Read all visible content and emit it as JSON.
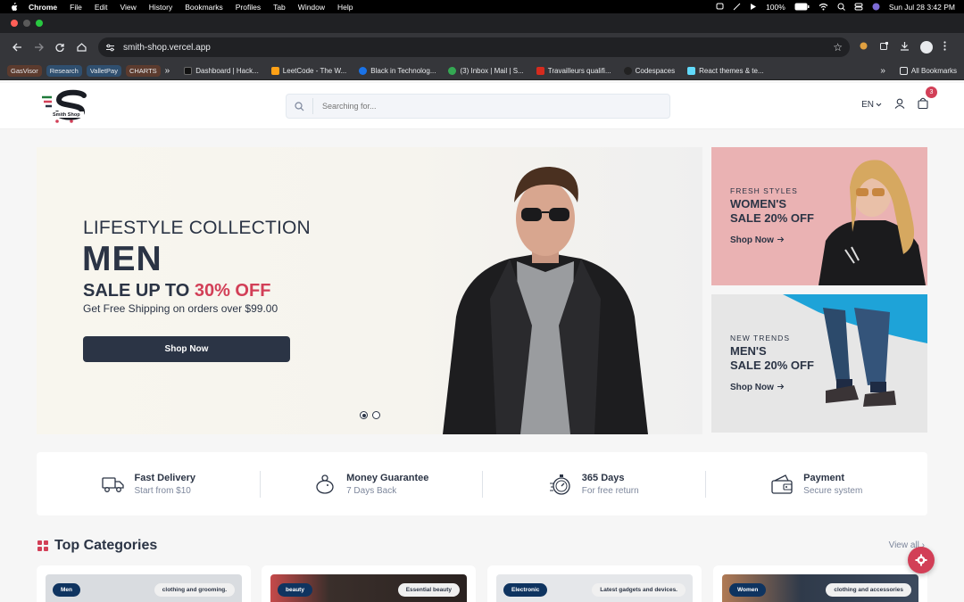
{
  "menubar": {
    "app": "Chrome",
    "items": [
      "File",
      "Edit",
      "View",
      "History",
      "Bookmarks",
      "Profiles",
      "Tab",
      "Window",
      "Help"
    ],
    "battery": "100%",
    "datetime": "Sun Jul 28  3:42 PM"
  },
  "browser": {
    "url": "smith-shop.vercel.app",
    "bookmark_chips": [
      {
        "label": "GasVisor",
        "color": "#5c3b2e"
      },
      {
        "label": "Research",
        "color": "#2f4f6f"
      },
      {
        "label": "ValletPay",
        "color": "#2f4f6f"
      },
      {
        "label": "CHARTS",
        "color": "#5c3b2e"
      }
    ],
    "bookmarks": [
      "Dashboard | Hack...",
      "LeetCode - The W...",
      "Black in Technolog...",
      "(3) Inbox | Mail | S...",
      "Travailleurs qualifi...",
      "Codespaces",
      "React themes & te..."
    ],
    "all_bookmarks": "All Bookmarks"
  },
  "header": {
    "logo_text": "Smith Shop",
    "search_placeholder": "Searching for...",
    "language": "EN",
    "cart_count": "3"
  },
  "hero": {
    "eyebrow": "LIFESTYLE COLLECTION",
    "title": "MEN",
    "sale_prefix": "SALE UP TO ",
    "sale_percent": "30% OFF",
    "subtitle": "Get Free Shipping on orders over $99.00",
    "button": "Shop Now",
    "slides": 2,
    "active_slide": 1
  },
  "promos": [
    {
      "tag": "FRESH STYLES",
      "line1": "WOMEN'S",
      "line2": "SALE 20% OFF",
      "link": "Shop Now"
    },
    {
      "tag": "NEW TRENDS",
      "line1": "MEN'S",
      "line2": "SALE 20% OFF",
      "link": "Shop Now"
    }
  ],
  "services": [
    {
      "title": "Fast Delivery",
      "subtitle": "Start from $10",
      "icon": "truck-icon"
    },
    {
      "title": "Money Guarantee",
      "subtitle": "7 Days Back",
      "icon": "piggy-bank-icon"
    },
    {
      "title": "365 Days",
      "subtitle": "For free return",
      "icon": "stopwatch-icon"
    },
    {
      "title": "Payment",
      "subtitle": "Secure system",
      "icon": "wallet-icon"
    }
  ],
  "categories": {
    "title": "Top Categories",
    "view_all": "View all",
    "items": [
      {
        "name": "Men",
        "desc": "clothing and grooming.",
        "color": "#d9dce0"
      },
      {
        "name": "beauty",
        "desc": "Essential beauty",
        "color": "#3a2f2b"
      },
      {
        "name": "Electronic",
        "desc": "Latest gadgets and devices.",
        "color": "#e5e7ea"
      },
      {
        "name": "Women",
        "desc": "clothing and accessories",
        "color": "#2f3a4a"
      }
    ]
  },
  "colors": {
    "primary": "#2b3445",
    "accent": "#d23f57",
    "navy_pill": "#0f3460"
  }
}
